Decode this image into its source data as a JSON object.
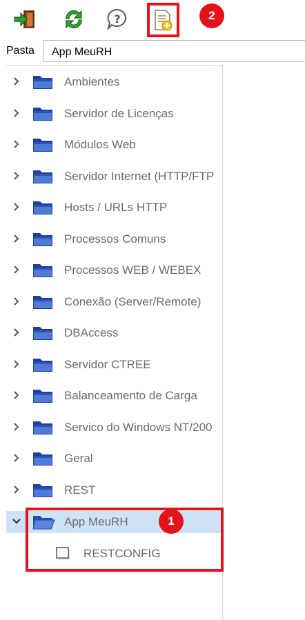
{
  "toolbar": {
    "buttons": [
      {
        "name": "exit-icon"
      },
      {
        "name": "refresh-icon"
      },
      {
        "name": "help-icon"
      },
      {
        "name": "new-item-icon"
      }
    ],
    "badge_2": "2"
  },
  "pasta": {
    "label": "Pasta",
    "value": "App MeuRH"
  },
  "tree": {
    "items": [
      {
        "label": "Ambientes"
      },
      {
        "label": "Servidor de Licenças"
      },
      {
        "label": "Módulos Web"
      },
      {
        "label": "Servidor Internet (HTTP/FTP"
      },
      {
        "label": "Hosts / URLs HTTP"
      },
      {
        "label": "Processos Comuns"
      },
      {
        "label": "Processos WEB / WEBEX"
      },
      {
        "label": "Conexão (Server/Remote)"
      },
      {
        "label": "DBAccess"
      },
      {
        "label": "Servidor CTREE"
      },
      {
        "label": "Balanceamento de Carga"
      },
      {
        "label": "Servico do Windows NT/200"
      },
      {
        "label": "Geral"
      },
      {
        "label": "REST"
      }
    ],
    "expanded": {
      "label": "App MeuRH",
      "child": "RESTCONFIG"
    },
    "badge_1": "1"
  },
  "colors": {
    "accent_red": "#e3131b",
    "selection": "#cfe3f7",
    "folder_blue": "#1f4fb4"
  }
}
